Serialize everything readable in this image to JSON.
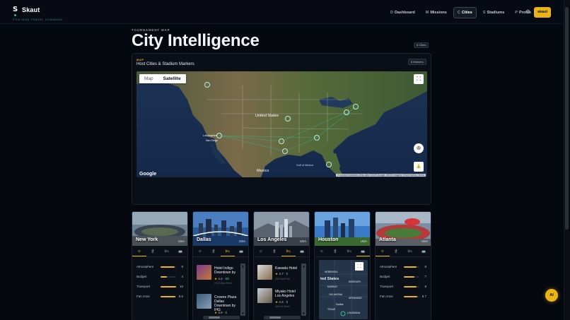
{
  "brand": {
    "name": "Skaut",
    "tagline": "FIFA 2026 TRAVEL COMMAND",
    "mark": "S"
  },
  "nav": {
    "items": [
      {
        "key": "D",
        "label": "Dashboard",
        "active": false
      },
      {
        "key": "M",
        "label": "Missions",
        "active": false
      },
      {
        "key": "C",
        "label": "Cities",
        "active": true
      },
      {
        "key": "S",
        "label": "Stadiums",
        "active": false
      },
      {
        "key": "P",
        "label": "Profile",
        "active": false
      }
    ],
    "settings_icon": "gear-icon",
    "user_label": "skaut"
  },
  "header": {
    "eyebrow": "TOURNAMENT MAP",
    "title": "City Intelligence",
    "count_badge": "6 Cities"
  },
  "map_card": {
    "eyebrow": "MAP",
    "title": "Host Cities & Stadium Markers",
    "markers_badge": "6 Markers",
    "toggle": {
      "map": "Map",
      "satellite": "Satellite",
      "selected": "Satellite"
    },
    "google": "Google",
    "attribution": "Keyboard shortcuts  |  Map data ©2026 Google, INEGI Imagery ©2026 NASA  |  Terms",
    "labels": {
      "us": "United States",
      "mexico": "Mexico",
      "gulf": "Gulf of Mexico",
      "la": "Los Angeles",
      "sd": "San Diego"
    },
    "icons": [
      "fullscreen-icon",
      "locate-icon",
      "pegman-icon"
    ]
  },
  "tabs": {
    "overview": "⊙",
    "food": "🍴",
    "hotels": "🛏",
    "transport": "🚌"
  },
  "cities": [
    {
      "name": "New York",
      "country": "USA",
      "active_tab": "overview",
      "metrics": [
        {
          "label": "Atmosphere",
          "value": "9",
          "fill": 0.9
        },
        {
          "label": "Budget",
          "value": "4",
          "fill": 0.4
        },
        {
          "label": "Transport",
          "value": "10",
          "fill": 1.0
        },
        {
          "label": "Fan zone",
          "value": "9.5",
          "fill": 0.95
        }
      ]
    },
    {
      "name": "Dallas",
      "country": "USA",
      "active_tab": "hotels",
      "hotels": [
        {
          "name": "Hotel Indigo Downtown by",
          "rating": "4.2",
          "price": "$$",
          "address": "1933 Main Street"
        },
        {
          "name": "Crowne Plaza Dallas Downtown by IHG",
          "rating": "3.9",
          "price": "$",
          "address": ""
        }
      ]
    },
    {
      "name": "Los Angeles",
      "country": "USA",
      "active_tab": "hotels",
      "hotels": [
        {
          "name": "Kawada Hotel",
          "rating": "3.7",
          "price": "$",
          "address": "200 South Hill"
        },
        {
          "name": "Miyako Hotel Los Angeles",
          "rating": "4.3",
          "price": "$",
          "address": "328 1st Street"
        }
      ]
    },
    {
      "name": "Houston",
      "country": "USA",
      "active_tab": "transport",
      "mini_map": {
        "label_big": "ted States",
        "states": [
          "NEBRASKA",
          "KANSAS",
          "OKLAHOMA",
          "TEXAS",
          "MISSOURI",
          "ARKANSAS",
          "LOUISIANA"
        ],
        "city": "Dallas"
      }
    },
    {
      "name": "Atlanta",
      "country": "USA",
      "active_tab": "overview",
      "metrics": [
        {
          "label": "Atmosphere",
          "value": "8",
          "fill": 0.8
        },
        {
          "label": "Budget",
          "value": "7",
          "fill": 0.7
        },
        {
          "label": "Transport",
          "value": "8",
          "fill": 0.8
        },
        {
          "label": "Fan zone",
          "value": "8.7",
          "fill": 0.87
        }
      ]
    }
  ],
  "ai_button": "AI",
  "colors": {
    "accent": "#e8b417",
    "bg": "#05080f",
    "marker": "#2ec08a"
  }
}
